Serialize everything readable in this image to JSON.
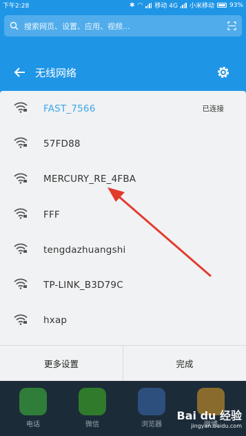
{
  "status_bar": {
    "time": "下午2:28",
    "carrier1": "移动 4G",
    "carrier2": "小米移动",
    "battery": "93%"
  },
  "search": {
    "placeholder": "搜索网页、设置、应用、视频..."
  },
  "header": {
    "title": "无线网络"
  },
  "networks": [
    {
      "ssid": "FAST_7566",
      "status": "已连接",
      "connected": true
    },
    {
      "ssid": "57FD88",
      "status": "",
      "connected": false
    },
    {
      "ssid": "MERCURY_RE_4FBA",
      "status": "",
      "connected": false
    },
    {
      "ssid": "FFF",
      "status": "",
      "connected": false
    },
    {
      "ssid": "tengdazhuangshi",
      "status": "",
      "connected": false
    },
    {
      "ssid": "TP-LINK_B3D79C",
      "status": "",
      "connected": false
    },
    {
      "ssid": "hxap",
      "status": "",
      "connected": false
    }
  ],
  "footer": {
    "more_settings": "更多设置",
    "done": "完成"
  },
  "dock": [
    {
      "label": "电话",
      "icon": "phone-icon",
      "color": "#3fae4b"
    },
    {
      "label": "微信",
      "icon": "wechat-icon",
      "color": "#41b035"
    },
    {
      "label": "浏览器",
      "icon": "browser-icon",
      "color": "#3a7ad8"
    },
    {
      "label": "微博",
      "icon": "weibo-icon",
      "color": "#e6a23c"
    }
  ],
  "watermark": {
    "brand": "Bai du 经验",
    "url": "jingyan.baidu.com"
  },
  "colors": {
    "accent": "#1f95e6",
    "connected_text": "#39a6e8",
    "annotation_arrow": "#e23b2e"
  }
}
